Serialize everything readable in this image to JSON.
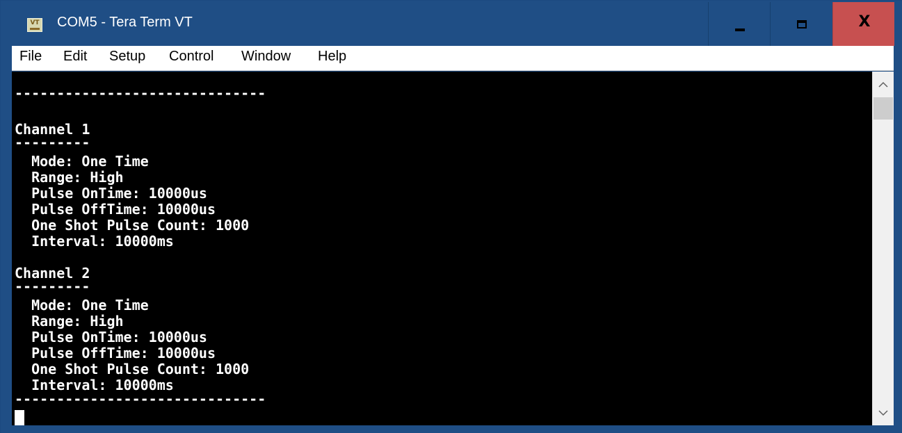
{
  "window": {
    "title": "COM5 - Tera Term VT",
    "app_icon_text": "VT",
    "minimize_icon": "minimize-icon",
    "maximize_icon": "maximize-icon",
    "close_icon": "close-icon",
    "close_glyph": "X"
  },
  "menu": {
    "items": [
      "File",
      "Edit",
      "Setup",
      "Control",
      "Window",
      "Help"
    ]
  },
  "terminal": {
    "lines": [
      "------------------------------",
      "",
      "Channel 1",
      "---------",
      "  Mode: One Time",
      "  Range: High",
      "  Pulse OnTime: 10000us",
      "  Pulse OffTime: 10000us",
      "  One Shot Pulse Count: 1000",
      "  Interval: 10000ms",
      "",
      "Channel 2",
      "---------",
      "  Mode: One Time",
      "  Range: High",
      "  Pulse OnTime: 10000us",
      "  Pulse OffTime: 10000us",
      "  One Shot Pulse Count: 1000",
      "  Interval: 10000ms",
      "------------------------------"
    ],
    "foreground": "#ffffff",
    "background": "#000000"
  },
  "scrollbar": {
    "up_glyph": "^",
    "down_glyph": "v"
  },
  "colors": {
    "titlebar": "#1f4e85",
    "close_button": "#c75050"
  }
}
